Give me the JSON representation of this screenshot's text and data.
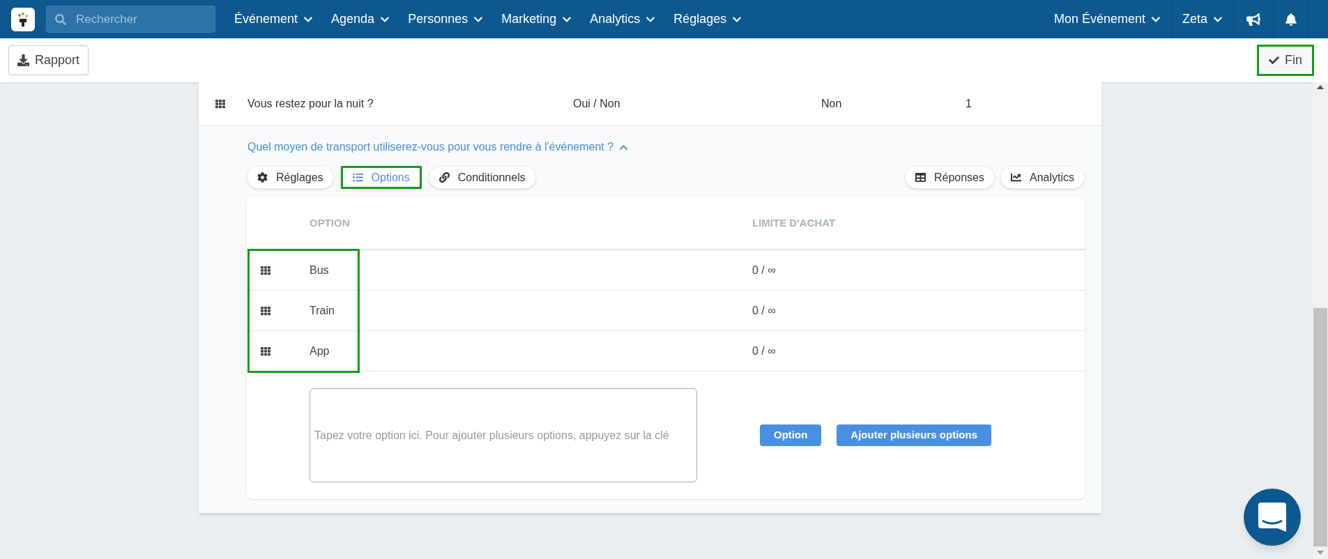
{
  "nav": {
    "search": {
      "placeholder": "Rechercher"
    },
    "menus": [
      "Événement",
      "Agenda",
      "Personnes",
      "Marketing",
      "Analytics",
      "Réglages"
    ],
    "right_menus": [
      "Mon Événement",
      "Zeta"
    ]
  },
  "toolbar": {
    "report_button": "Rapport",
    "done_button": {
      "label": "Fin",
      "highlighted": true
    }
  },
  "question_row": {
    "cells": [
      "Vous restez pour la nuit ?",
      "Oui / Non",
      "Non",
      "1"
    ]
  },
  "question": {
    "title": "Quel moyen de transport utiliserez-vous pour vous rendre à l'événement ?",
    "expanded": true,
    "tabs": [
      {
        "label": "Réglages",
        "selected": false,
        "highlighted": false
      },
      {
        "label": "Options",
        "selected": true,
        "highlighted": true
      },
      {
        "label": "Conditionnels",
        "selected": false,
        "highlighted": false
      }
    ],
    "right_tabs": [
      {
        "label": "Réponses"
      },
      {
        "label": "Analytics"
      }
    ]
  },
  "options_table": {
    "columns": [
      "OPTION",
      "LIMITE D'ACHAT"
    ],
    "rows_highlighted": true,
    "rows": [
      {
        "option": "Bus",
        "limit": "0 / ∞"
      },
      {
        "option": "Train",
        "limit": "0 / ∞"
      },
      {
        "option": "App",
        "limit": "0 / ∞"
      }
    ]
  },
  "new_option": {
    "placeholder": "Tapez votre option ici. Pour ajouter plusieurs options, appuyez sur la clé",
    "buttons": [
      "Option",
      "Ajouter plusieurs options"
    ]
  }
}
